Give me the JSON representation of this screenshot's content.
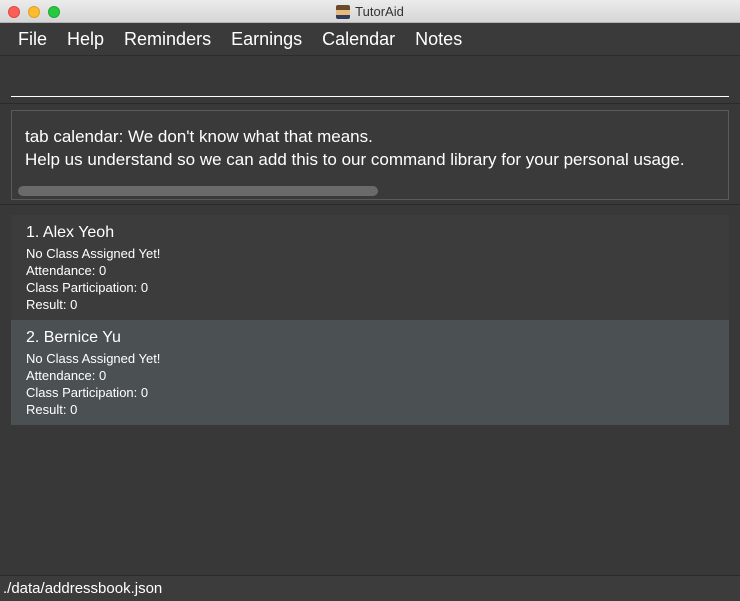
{
  "window": {
    "title": "TutorAid",
    "app_icon": "tutoraid-app-icon"
  },
  "menu": {
    "items": [
      {
        "label": "File"
      },
      {
        "label": "Help"
      },
      {
        "label": "Reminders"
      },
      {
        "label": "Earnings"
      },
      {
        "label": "Calendar"
      },
      {
        "label": "Notes"
      }
    ]
  },
  "command": {
    "value": "",
    "placeholder": ""
  },
  "result": {
    "line1": "tab calendar: We don't know what that means.",
    "line2": "Help us understand so we can add this to our command library for your personal usage."
  },
  "persons": [
    {
      "index_name": "1.  Alex Yeoh",
      "class": "No Class Assigned Yet!",
      "attendance": "Attendance: 0",
      "participation": "Class Participation: 0",
      "result": "Result: 0"
    },
    {
      "index_name": "2.  Bernice Yu",
      "class": "No Class Assigned Yet!",
      "attendance": "Attendance: 0",
      "participation": "Class Participation: 0",
      "result": "Result: 0"
    }
  ],
  "status": {
    "path": "./data/addressbook.json"
  },
  "colors": {
    "background": "#383838",
    "card_selected": "#4b5052",
    "text": "#ffffff"
  }
}
